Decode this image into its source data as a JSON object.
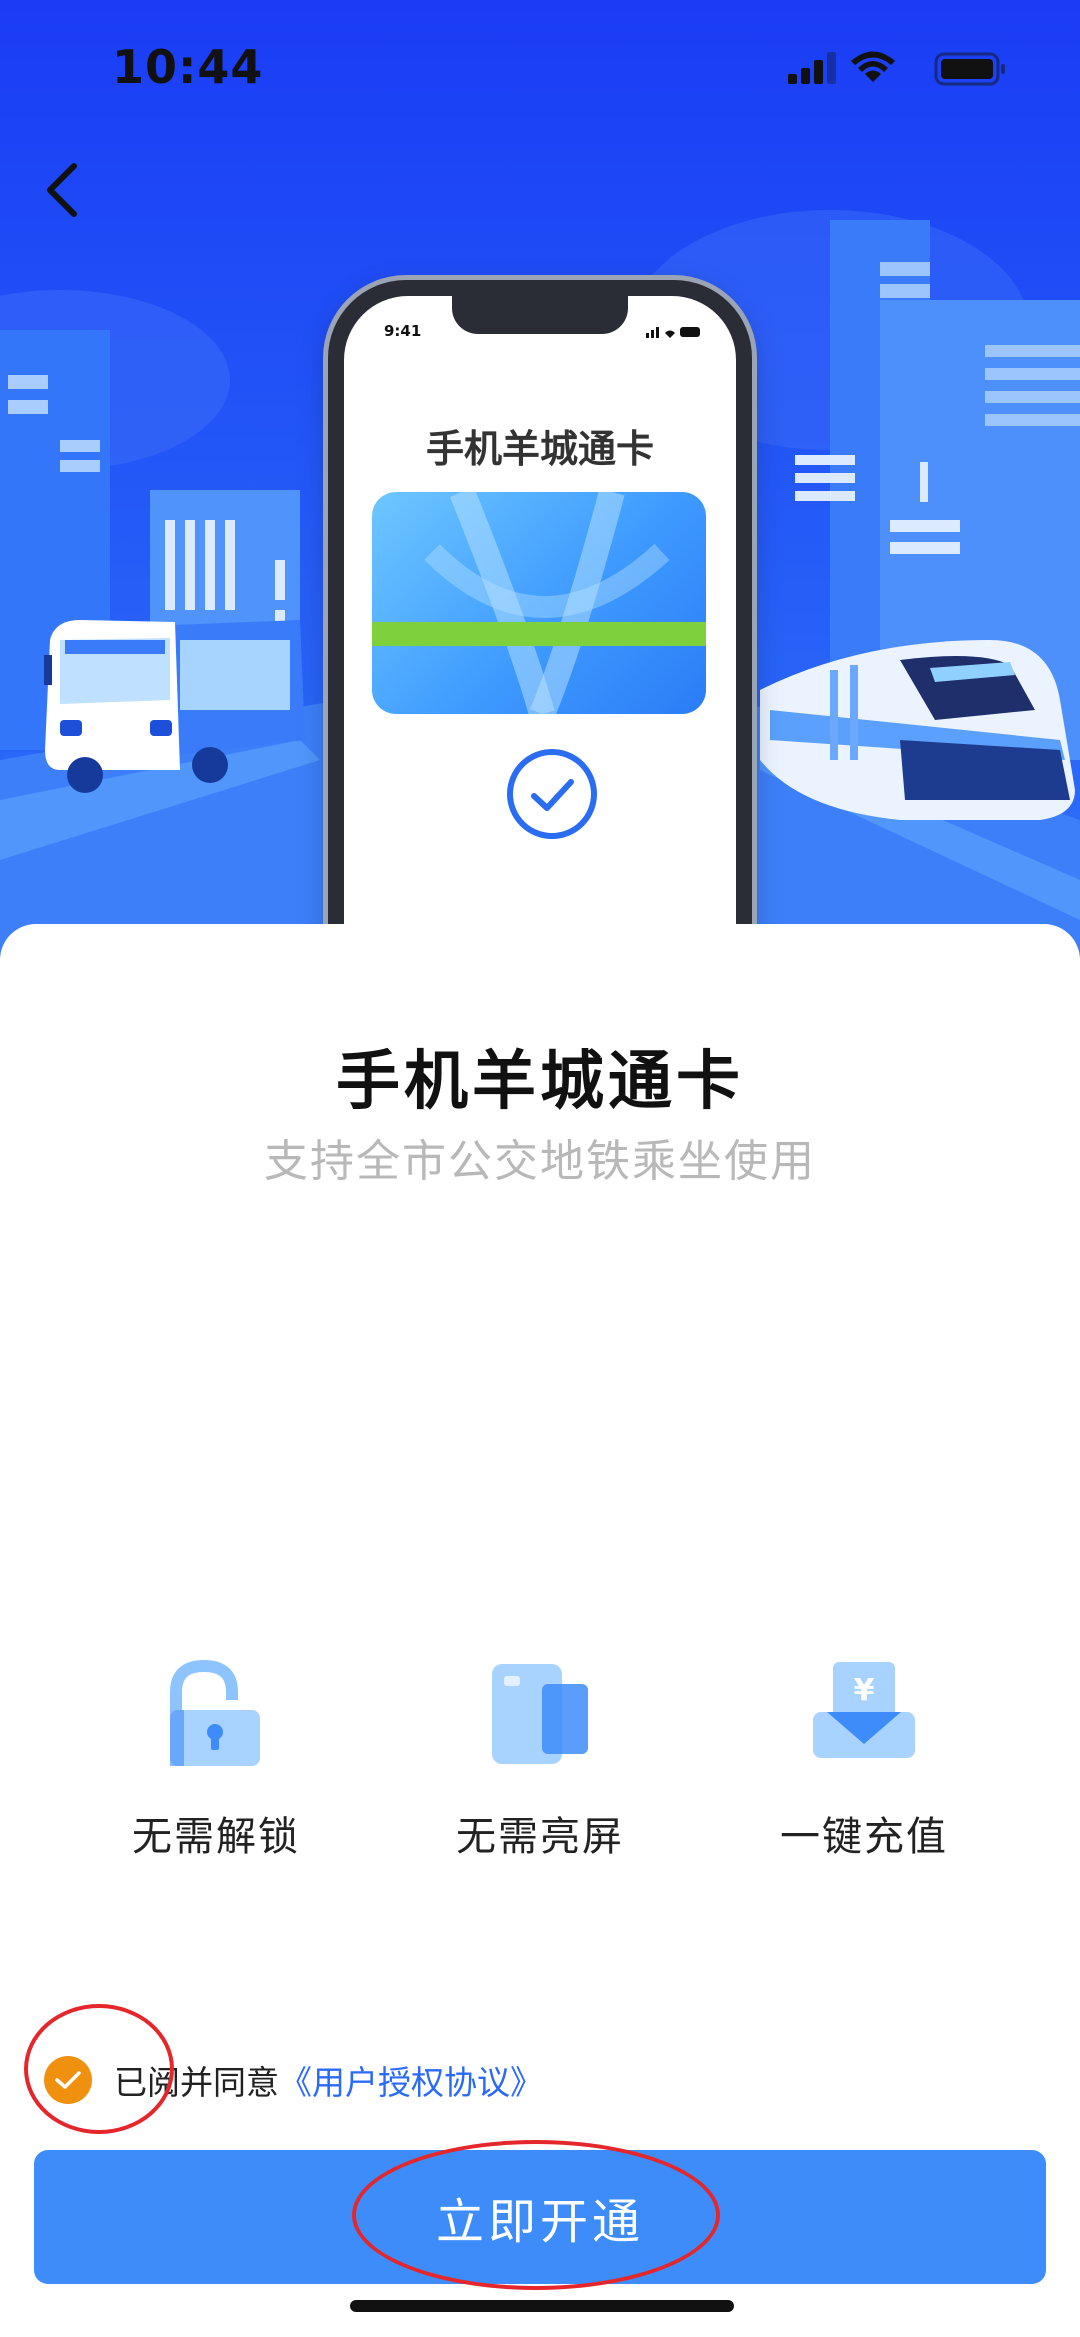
{
  "status_bar": {
    "time": "10:44"
  },
  "hero": {
    "phone_time": "9:41",
    "phone_title": "手机羊城通卡"
  },
  "main": {
    "title": "手机羊城通卡",
    "subtitle": "支持全市公交地铁乘坐使用"
  },
  "features": [
    {
      "label": "无需解锁",
      "icon": "unlock-icon"
    },
    {
      "label": "无需亮屏",
      "icon": "card-screen-icon"
    },
    {
      "label": "一键充值",
      "icon": "yuan-topup-icon"
    }
  ],
  "agreement": {
    "prefix": "已阅并同意",
    "link": "《用户授权协议》",
    "checked": true
  },
  "cta": {
    "label": "立即开通"
  },
  "colors": {
    "hero_blue": "#2255f7",
    "cta_blue": "#3d8cf9",
    "check_orange": "#f0900f",
    "link_blue": "#2b6af6",
    "annotation_red": "#e5262a"
  }
}
